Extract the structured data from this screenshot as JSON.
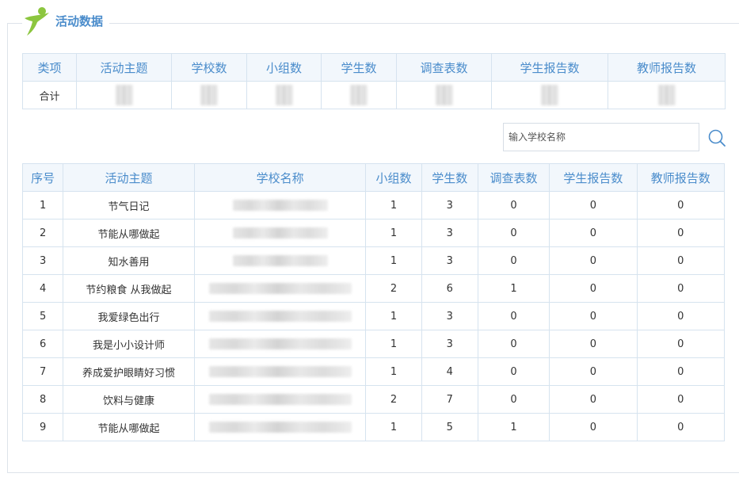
{
  "header": {
    "title": "活动数据",
    "logo_icon": "running-figure-icon"
  },
  "summary": {
    "headers": [
      "类项",
      "活动主题",
      "学校数",
      "小组数",
      "学生数",
      "调查表数",
      "学生报告数",
      "教师报告数"
    ],
    "row_label": "合计"
  },
  "search": {
    "placeholder": "输入学校名称",
    "value": ""
  },
  "detail": {
    "headers": [
      "序号",
      "活动主题",
      "学校名称",
      "小组数",
      "学生数",
      "调查表数",
      "学生报告数",
      "教师报告数"
    ],
    "rows": [
      {
        "index": "1",
        "theme": "节气日记",
        "groups": "1",
        "students": "3",
        "surveys": "0",
        "student_reports": "0",
        "teacher_reports": "0"
      },
      {
        "index": "2",
        "theme": "节能从哪做起",
        "groups": "1",
        "students": "3",
        "surveys": "0",
        "student_reports": "0",
        "teacher_reports": "0"
      },
      {
        "index": "3",
        "theme": "知水善用",
        "groups": "1",
        "students": "3",
        "surveys": "0",
        "student_reports": "0",
        "teacher_reports": "0"
      },
      {
        "index": "4",
        "theme": "节约粮食 从我做起",
        "groups": "2",
        "students": "6",
        "surveys": "1",
        "student_reports": "0",
        "teacher_reports": "0"
      },
      {
        "index": "5",
        "theme": "我爱绿色出行",
        "groups": "1",
        "students": "3",
        "surveys": "0",
        "student_reports": "0",
        "teacher_reports": "0"
      },
      {
        "index": "6",
        "theme": "我是小小设计师",
        "groups": "1",
        "students": "3",
        "surveys": "0",
        "student_reports": "0",
        "teacher_reports": "0"
      },
      {
        "index": "7",
        "theme": "养成爱护眼睛好习惯",
        "groups": "1",
        "students": "4",
        "surveys": "0",
        "student_reports": "0",
        "teacher_reports": "0"
      },
      {
        "index": "8",
        "theme": "饮料与健康",
        "groups": "2",
        "students": "7",
        "surveys": "0",
        "student_reports": "0",
        "teacher_reports": "0"
      },
      {
        "index": "9",
        "theme": "节能从哪做起",
        "groups": "1",
        "students": "5",
        "surveys": "1",
        "student_reports": "0",
        "teacher_reports": "0"
      }
    ]
  },
  "colors": {
    "accent": "#4a8ccb",
    "header_bg": "#f2f7fc",
    "border": "#d6e3ef",
    "logo_green": "#8cc63f"
  }
}
